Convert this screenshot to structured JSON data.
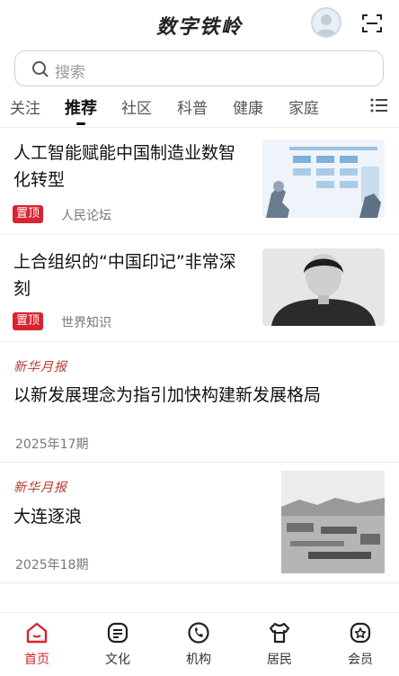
{
  "header": {
    "title": "数字铁岭"
  },
  "search": {
    "placeholder": "搜索"
  },
  "tabs": [
    {
      "label": "关注"
    },
    {
      "label": "推荐"
    },
    {
      "label": "社区"
    },
    {
      "label": "科普"
    },
    {
      "label": "健康"
    },
    {
      "label": "家庭"
    }
  ],
  "articles": [
    {
      "title_line1": "人工智能赋能中国制造业数智",
      "title_line2": "化转型",
      "badge": "置顶",
      "source": "人民论坛"
    },
    {
      "title_line1": "上合组织的“中国印记”非常深",
      "title_line2": "刻",
      "badge": "置顶",
      "source": "世界知识"
    },
    {
      "logo": "新华月报",
      "title": "以新发展理念为指引加快构建新发展格局",
      "issue": "2025年17期"
    },
    {
      "logo": "新华月报",
      "title": "大连逐浪",
      "issue": "2025年18期"
    }
  ],
  "bottom_nav": [
    {
      "label": "首页"
    },
    {
      "label": "文化"
    },
    {
      "label": "机构"
    },
    {
      "label": "居民"
    },
    {
      "label": "会员"
    }
  ],
  "colors": {
    "accent": "#d9232e",
    "text": "#111111",
    "muted": "#777777"
  }
}
